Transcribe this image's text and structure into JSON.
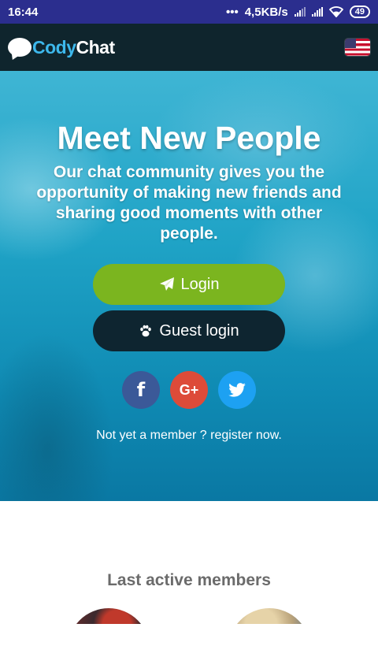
{
  "status_bar": {
    "time": "16:44",
    "dots": "•••",
    "speed": "4,5KB/s",
    "battery": "49"
  },
  "header": {
    "logo_part1": "Cody",
    "logo_part2": "Chat",
    "language_icon": "us-flag-icon"
  },
  "hero": {
    "title": "Meet New People",
    "subtitle": "Our chat community gives you the opportunity of making new friends and sharing good moments with other people.",
    "login_label": "Login",
    "guest_label": "Guest login",
    "social": {
      "facebook": "f",
      "google": "G+"
    },
    "register_text": "Not yet a member ? register now."
  },
  "members": {
    "title": "Last active members"
  },
  "colors": {
    "status_bar": "#2b2e8e",
    "header": "#0f252d",
    "login_button": "#7bb51f",
    "guest_button": "#0e2530",
    "facebook": "#3b5998",
    "google": "#dd4b39",
    "twitter": "#1da1f2"
  }
}
